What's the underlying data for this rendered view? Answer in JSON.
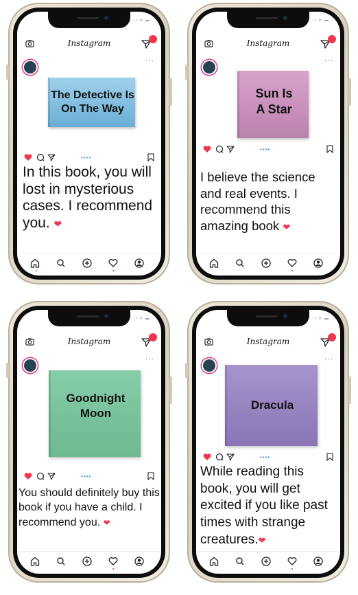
{
  "app": {
    "logo": "Instagram",
    "status": ".ıl ᯤ ▬"
  },
  "colors": {
    "accent": "#f0364f",
    "story_ring": "#e13a7f",
    "avatar": "#264353"
  },
  "posts": [
    {
      "book_title": "The Detective Is On The Way",
      "book_color": "#8ec6e6",
      "caption": "In this book, you will lost in mysterious cases. I recommend you.",
      "heart": "❤"
    },
    {
      "book_title": "Sun Is A Star",
      "book_color": "#d39cc3",
      "caption": "I believe the science and real events. I recommend this amazing book",
      "heart": "❤"
    },
    {
      "book_title": "Goodnight Moon",
      "book_color": "#7fc4a0",
      "caption": "You should definitely buy this book if you have a child. I recommend you.",
      "heart": "❤"
    },
    {
      "book_title": "Dracula",
      "book_color": "#9a86c2",
      "caption": "While reading this book, you will get excited if you like past times with strange creatures.",
      "heart": "❤"
    }
  ],
  "icons": [
    "camera-icon",
    "send-icon",
    "more-icon",
    "like-icon",
    "comment-icon",
    "share-icon",
    "save-icon",
    "home-icon",
    "search-icon",
    "add-icon",
    "activity-icon",
    "profile-icon"
  ]
}
